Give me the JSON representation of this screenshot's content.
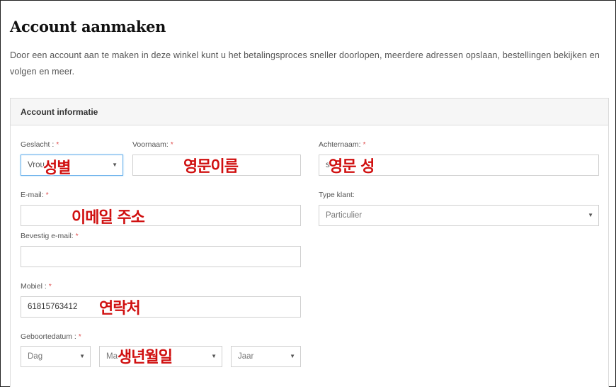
{
  "page": {
    "title": "Account aanmaken",
    "intro": "Door een account aan te maken in deze winkel kunt u het betalingsproces sneller doorlopen, meerdere adressen opslaan, bestellingen bekijken en volgen en meer."
  },
  "form": {
    "section_title": "Account informatie",
    "required_mark": "*",
    "gender": {
      "label": "Geslacht :",
      "value": "Vrou"
    },
    "first_name": {
      "label": "Voornaam:",
      "value": ""
    },
    "last_name": {
      "label": "Achternaam:",
      "value": "s"
    },
    "email": {
      "label": "E-mail:",
      "value": ""
    },
    "customer_type": {
      "label": "Type klant:",
      "value": "Particulier"
    },
    "confirm_email": {
      "label": "Bevestig e-mail:",
      "value": ""
    },
    "mobile": {
      "label": "Mobiel :",
      "value": "61815763412"
    },
    "birthdate": {
      "label": "Geboortedatum :",
      "day": "Dag",
      "month": "Ma",
      "year": "Jaar"
    }
  },
  "annotations": {
    "gender": "성별",
    "first_name": "영문이름",
    "last_name": "영문 성",
    "email": "이메일 주소",
    "mobile": "연락처",
    "birthdate": "생년월일"
  },
  "icons": {
    "select_arrow": "chevron-down-icon"
  },
  "colors": {
    "required": "#e05252",
    "annotation": "#d01010",
    "focus": "#6cb2eb"
  }
}
